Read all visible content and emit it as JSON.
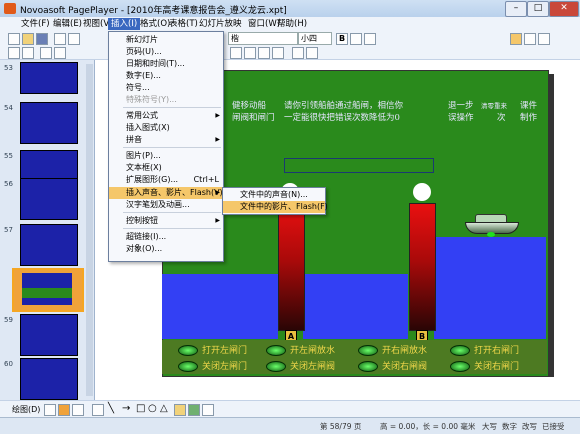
{
  "window": {
    "title": "Novoasoft PagePlayer - [2010年高考课意报告会_遵义龙云.xpt]"
  },
  "menubar": [
    "文件(F)",
    "编辑(E)",
    "视图(V)",
    "插入(I)",
    "格式(O)",
    "表格(T)",
    "幻灯片放映",
    "窗口(W)",
    "帮助(H)"
  ],
  "toolbar": {
    "font_combo": "楷",
    "size_combo": "小四"
  },
  "insert_menu": {
    "items": [
      {
        "label": "新幻灯片",
        "arrow": false,
        "disabled": false
      },
      {
        "label": "页码(U)...",
        "arrow": false,
        "disabled": false
      },
      {
        "label": "日期和时间(T)...",
        "arrow": false,
        "disabled": false
      },
      {
        "label": "数字(E)...",
        "arrow": false,
        "disabled": false
      },
      {
        "label": "符号...",
        "arrow": false,
        "disabled": false
      },
      {
        "label": "特殊符号(Y)...",
        "arrow": false,
        "disabled": true
      },
      {
        "label": "常用公式",
        "arrow": true,
        "disabled": false
      },
      {
        "label": "插入图式(X)",
        "arrow": false,
        "disabled": false
      },
      {
        "label": "拼音",
        "arrow": true,
        "disabled": false
      },
      {
        "label": "图片(P)...",
        "arrow": false,
        "disabled": false
      },
      {
        "label": "文本框(X)",
        "arrow": false,
        "disabled": false
      },
      {
        "label": "扩展图形(G)...",
        "shortcut": "Ctrl+L",
        "arrow": false,
        "disabled": false
      },
      {
        "label": "插入声音、影片、Flash(V)",
        "arrow": true,
        "disabled": false,
        "highlight": true
      },
      {
        "label": "汉字笔划及动画...",
        "arrow": false,
        "disabled": false
      },
      {
        "label": "控制按钮",
        "arrow": true,
        "disabled": false
      },
      {
        "label": "超链接(I)...",
        "arrow": false,
        "disabled": false
      },
      {
        "label": "对象(O)...",
        "arrow": false,
        "disabled": false
      }
    ]
  },
  "submenu": {
    "items": [
      "文件中的声音(N)...",
      "文件中的影片、Flash(F)"
    ]
  },
  "slide": {
    "instr_left": "健移动船",
    "instr_left2": "闸阀和闸门",
    "instr_main1": "请你引领船舶通过船闸，相信你",
    "instr_main2": "一定能很快把错误次数降低为0",
    "next_step": "退一步",
    "wrong_ops": "误操作",
    "count_label": "清零重来",
    "count_val": "次",
    "credit1": "课件",
    "credit2": "制作",
    "gate_a": "A",
    "gate_b": "B",
    "controls": [
      {
        "label": "打开左闸门"
      },
      {
        "label": "开左闸放水"
      },
      {
        "label": "开右闸放水"
      },
      {
        "label": "打开右闸门"
      },
      {
        "label": "关闭左闸门"
      },
      {
        "label": "关闭左闸阀"
      },
      {
        "label": "关闭右闸阀"
      },
      {
        "label": "关闭右闸门"
      }
    ]
  },
  "thumbnails": [
    {
      "num": "53"
    },
    {
      "num": "54"
    },
    {
      "num": "55"
    },
    {
      "num": "56"
    },
    {
      "num": "57"
    },
    {
      "num": "58"
    },
    {
      "num": "59"
    },
    {
      "num": "60"
    }
  ],
  "bottom_toolbar": {
    "draw_label": "绘图(D)"
  },
  "statusbar": {
    "page": "第 58/79 页",
    "pos": "高 = 0.00，长 = 0.00 毫米",
    "caps": "大写",
    "num": "数字",
    "ovr": "改写",
    "rec": "已接受"
  }
}
